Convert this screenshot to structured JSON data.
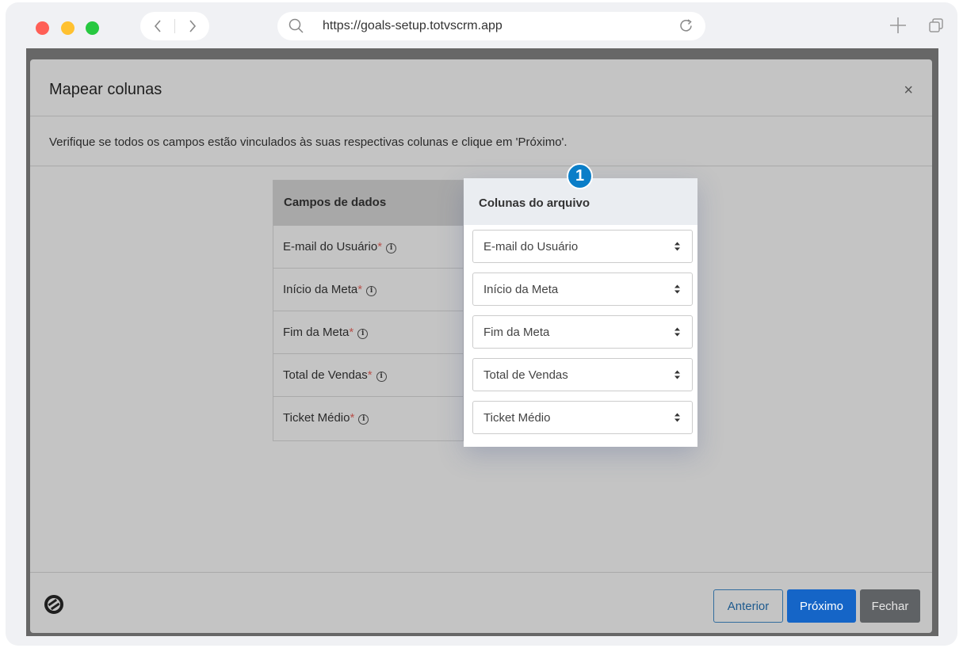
{
  "browser": {
    "url": "https://goals-setup.totvscrm.app"
  },
  "modal": {
    "title": "Mapear colunas",
    "close_symbol": "×",
    "instruction": "Verifique se todos os campos estão vinculados às suas respectivas colunas e clique em 'Próximo'.",
    "table": {
      "header_fields": "Campos de dados",
      "header_columns": "Colunas do arquivo",
      "required_marker": "*",
      "info_symbol": "i",
      "rows": [
        {
          "field": "E-mail do Usuário",
          "selected": "E-mail do Usuário"
        },
        {
          "field": "Início da Meta",
          "selected": "Início da Meta"
        },
        {
          "field": "Fim da Meta",
          "selected": "Fim da Meta"
        },
        {
          "field": "Total de Vendas",
          "selected": "Total de Vendas"
        },
        {
          "field": "Ticket Médio",
          "selected": "Ticket Médio"
        }
      ]
    },
    "step_badge": "1",
    "buttons": {
      "previous": "Anterior",
      "next": "Próximo",
      "close": "Fechar"
    }
  },
  "colors": {
    "primary": "#1565c7",
    "badge": "#0a7ec8",
    "required": "#b8504a"
  },
  "icons": {
    "search": "search-icon",
    "reload": "reload-icon",
    "plus": "plus-icon",
    "tabs": "tabs-icon",
    "logo": "totvs-logo-icon"
  }
}
